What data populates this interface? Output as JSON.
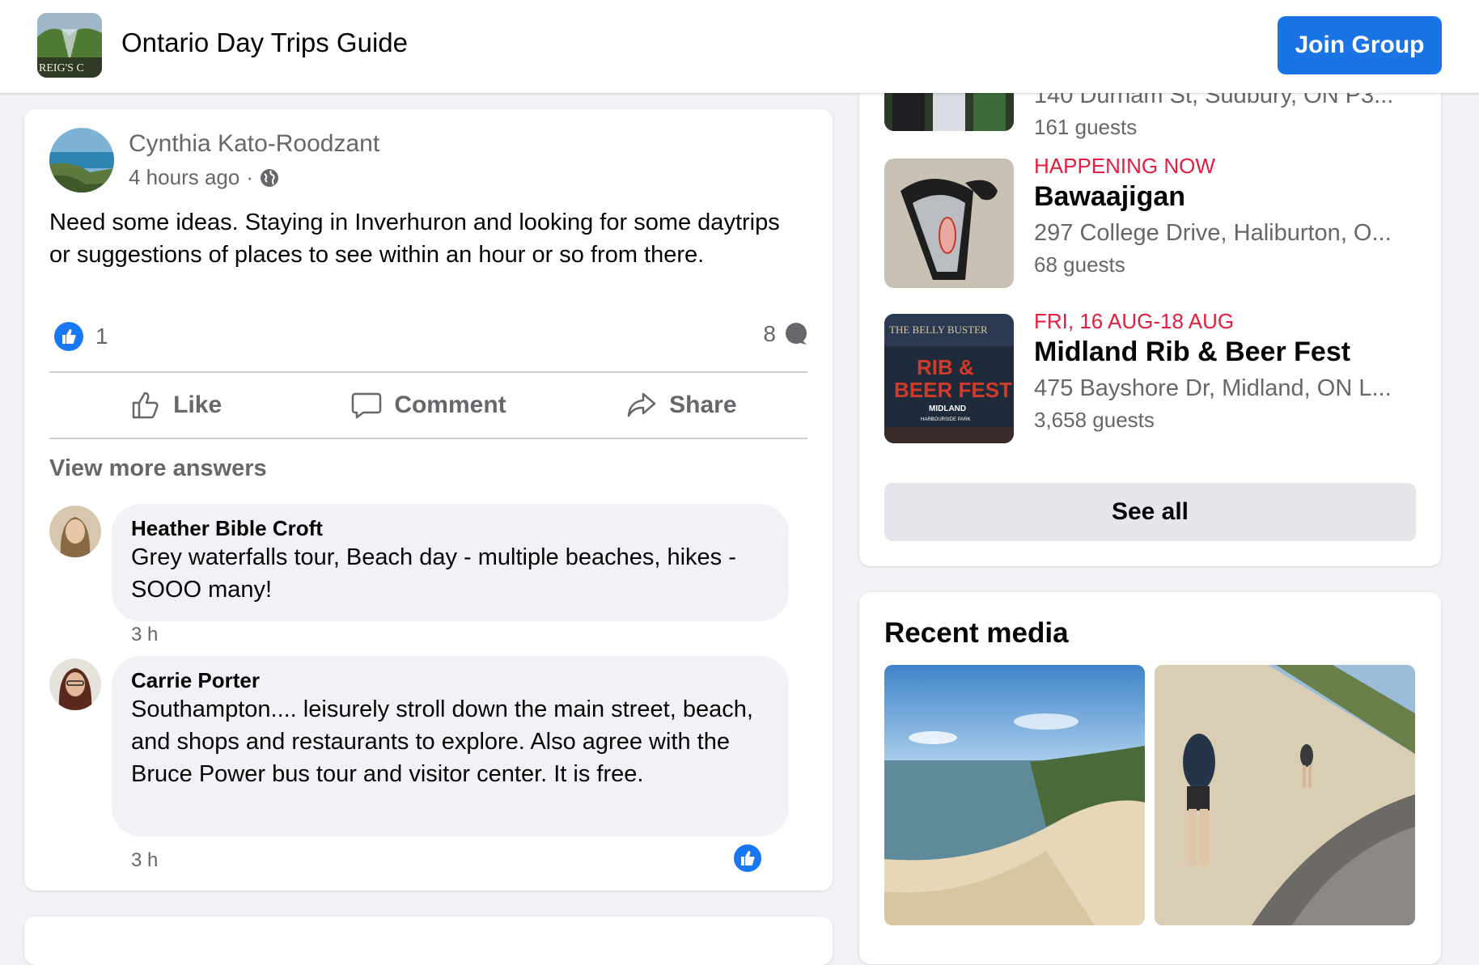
{
  "header": {
    "group_name": "Ontario Day Trips Guide",
    "thumb_text": "REIG'S C",
    "join_label": "Join Group"
  },
  "post": {
    "author": "Cynthia Kato-Roodzant",
    "time": "4 hours ago",
    "separator": "·",
    "text": "Need some ideas. Staying in Inverhuron and looking for some daytrips or suggestions of places to see within an hour or so from there.",
    "like_count": "1",
    "comment_count": "8",
    "actions": {
      "like": "Like",
      "comment": "Comment",
      "share": "Share"
    },
    "view_more": "View more answers",
    "comments": [
      {
        "name": "Heather Bible Croft",
        "text": "Grey waterfalls tour, Beach day - multiple beaches, hikes - SOOO many!",
        "time": "3 h"
      },
      {
        "name": "Carrie Porter",
        "text": "Southampton.... leisurely stroll down the main street, beach, and shops and restaurants to explore. Also agree with the Bruce Power bus tour and visitor center. It is free.",
        "time": "3 h"
      }
    ]
  },
  "events": {
    "items": [
      {
        "location": "140 Durham St, Sudbury, ON P3...",
        "guests": "161 guests"
      },
      {
        "date": "HAPPENING NOW",
        "title": "Bawaajigan",
        "location": "297 College Drive, Haliburton, O...",
        "guests": "68 guests"
      },
      {
        "date": "FRI, 16 AUG-18 AUG",
        "title": "Midland Rib & Beer Fest",
        "location": "475 Bayshore Dr, Midland, ON L...",
        "guests": "3,658 guests",
        "poster": {
          "top": "THE BELLY BUSTER",
          "main1": "RIB &",
          "main2": "BEER FEST",
          "city": "MIDLAND",
          "venue": "HARBOURSIDE PARK"
        }
      }
    ],
    "see_all": "See all"
  },
  "media": {
    "title": "Recent media"
  },
  "colors": {
    "brand_blue": "#1b74e4",
    "event_date_red": "#e41e3f",
    "secondary_text": "#65676b",
    "page_bg": "#f0f2f5"
  },
  "icons": [
    "globe-icon",
    "like-reaction-icon",
    "comment-bubble-icon",
    "thumbs-up-icon",
    "comment-icon",
    "share-icon"
  ]
}
